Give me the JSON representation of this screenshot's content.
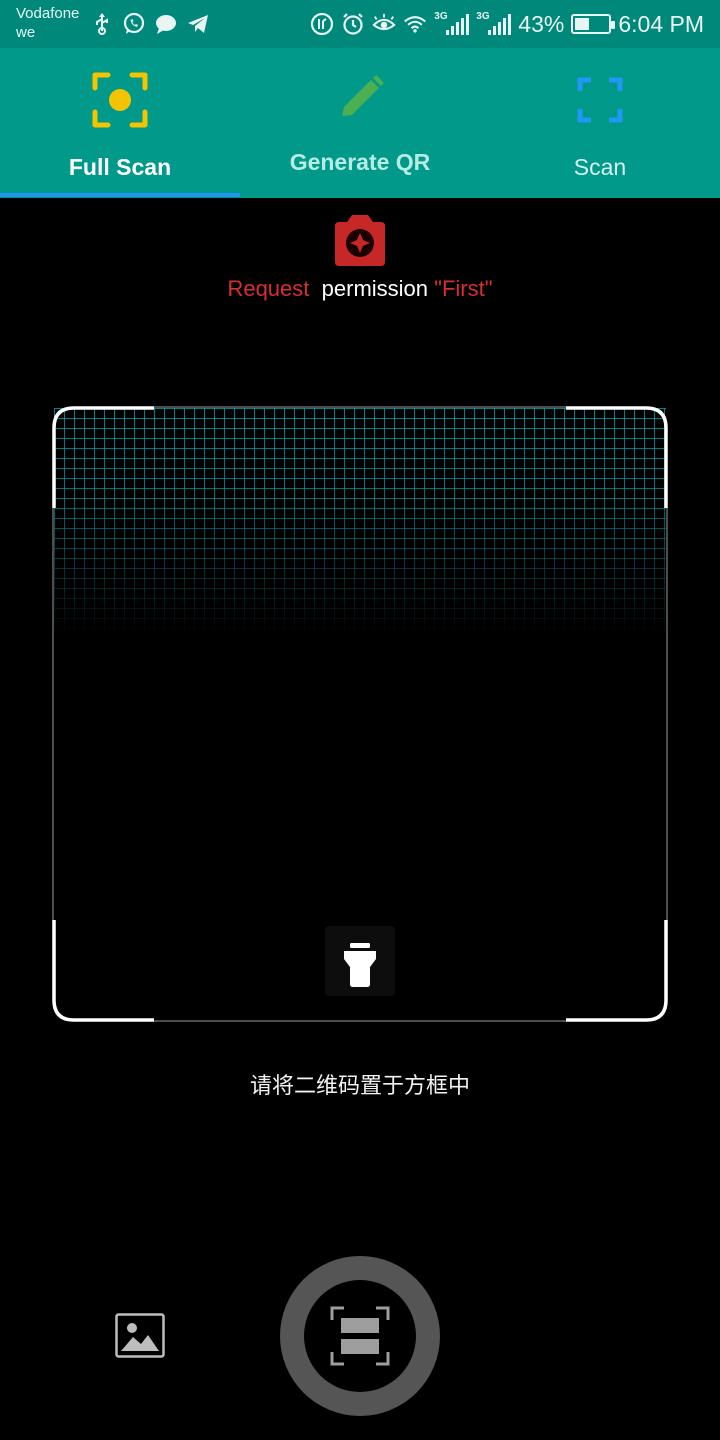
{
  "status_bar": {
    "carrier_line1": "Vodafone",
    "carrier_line2": "we",
    "left_icons": [
      "usb-icon",
      "whatsapp-icon",
      "chat-bubble-icon",
      "telegram-icon"
    ],
    "right_icons": [
      "data-saver-icon",
      "alarm-icon",
      "eye-comfort-icon",
      "wifi-icon",
      "signal-3g-icon",
      "signal-3g-icon",
      "battery-charging-icon"
    ],
    "network_type": "3G",
    "battery_percent": "43%",
    "battery_level": 0.43,
    "time": "6:04 PM"
  },
  "tabs": [
    {
      "label": "Full Scan",
      "icon": "focus-scan-icon",
      "icon_color": "#F5C400",
      "selected": true
    },
    {
      "label": "Generate QR",
      "icon": "pencil-icon",
      "icon_color": "#4CAF50",
      "selected": false
    },
    {
      "label": "Scan",
      "icon": "scan-frame-icon",
      "icon_color": "#2196F3",
      "selected": false
    }
  ],
  "colors": {
    "status_bar_bg": "#00897B",
    "tab_bar_bg": "#00998A",
    "tab_indicator": "#2196F3",
    "accent_red": "#D62F2F",
    "scan_grid": "#00AAB4"
  },
  "permission": {
    "icon": "camera-icon",
    "word_request": "Request",
    "word_permission": "permission",
    "word_first": "\"First\""
  },
  "scanner": {
    "torch_icon": "flashlight-icon",
    "hint": "请将二维码置于方框中"
  },
  "bottom_bar": {
    "gallery_icon": "gallery-icon",
    "shutter_icon": "scan-shutter-icon"
  }
}
